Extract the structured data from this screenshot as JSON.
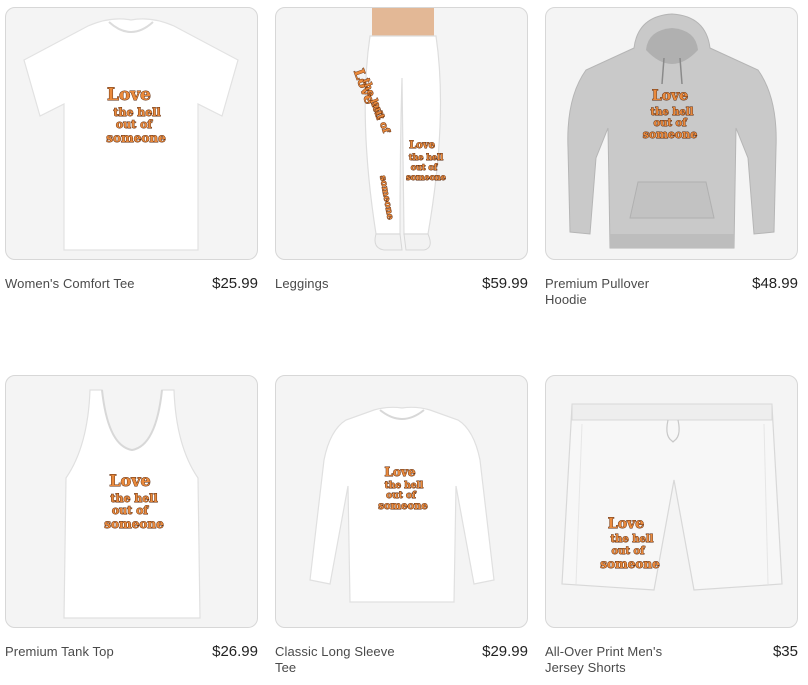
{
  "products": [
    {
      "name": "Women's Comfort Tee",
      "price": "$25.99",
      "image": "womens-comfort-tee"
    },
    {
      "name": "Leggings",
      "price": "$59.99",
      "image": "leggings"
    },
    {
      "name": "Premium Pullover Hoodie",
      "price": "$48.99",
      "image": "premium-pullover-hoodie"
    },
    {
      "name": "Premium Tank Top",
      "price": "$26.99",
      "image": "premium-tank-top"
    },
    {
      "name": "Classic Long Sleeve Tee",
      "price": "$29.99",
      "image": "classic-long-sleeve-tee"
    },
    {
      "name": "All-Over Print Men's Jersey Shorts",
      "price": "$35",
      "image": "all-over-print-mens-jersey-shorts"
    }
  ],
  "design_text": [
    "Love",
    "the hell",
    "out of",
    "someone"
  ],
  "colors": {
    "design_fill": "#ea8a3c",
    "design_outline": "#5a2a10",
    "hoodie": "#c9c9c9",
    "card_border": "#d7d7d7"
  }
}
